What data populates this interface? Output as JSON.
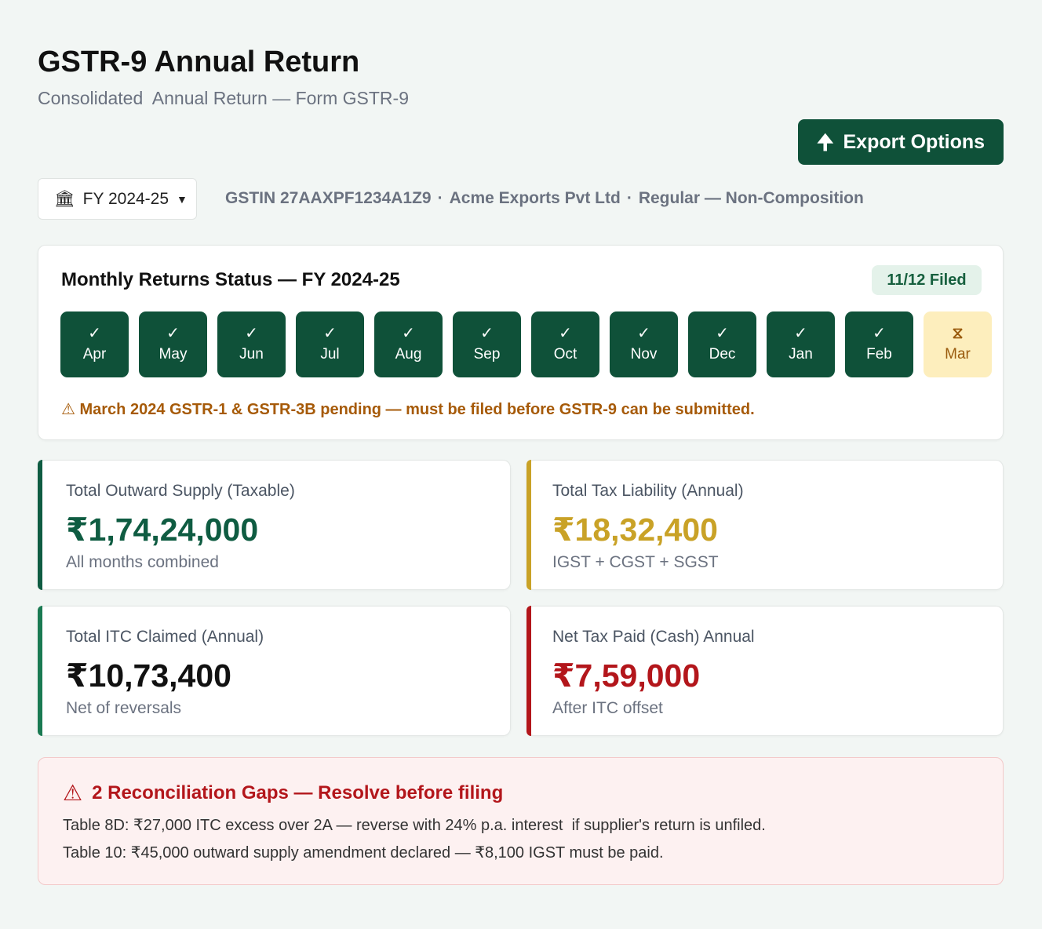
{
  "header": {
    "title": "GSTR-9 Annual Return",
    "subtitle": "Consolidated  Annual Return — Form GSTR-9",
    "export_label": "Export Options",
    "export_icon": "upload-arrow-icon"
  },
  "filters": {
    "fy_label": "FY 2024-25",
    "fy_icon": "bank-icon",
    "gstin": "GSTIN 27AAXPF1234A1Z9",
    "company": "Acme Exports Pvt Ltd",
    "taxpayer_type": "Regular — Non-Composition"
  },
  "status": {
    "title": "Monthly Returns Status — FY 2024-25",
    "filed_badge": "11/12 Filed",
    "months": [
      {
        "label": "Apr",
        "mark": "✓",
        "state": "filed"
      },
      {
        "label": "May",
        "mark": "✓",
        "state": "filed"
      },
      {
        "label": "Jun",
        "mark": "✓",
        "state": "filed"
      },
      {
        "label": "Jul",
        "mark": "✓",
        "state": "filed"
      },
      {
        "label": "Aug",
        "mark": "✓",
        "state": "filed"
      },
      {
        "label": "Sep",
        "mark": "✓",
        "state": "filed"
      },
      {
        "label": "Oct",
        "mark": "✓",
        "state": "filed"
      },
      {
        "label": "Nov",
        "mark": "✓",
        "state": "filed"
      },
      {
        "label": "Dec",
        "mark": "✓",
        "state": "filed"
      },
      {
        "label": "Jan",
        "mark": "✓",
        "state": "filed"
      },
      {
        "label": "Feb",
        "mark": "✓",
        "state": "filed"
      },
      {
        "label": "Mar",
        "mark": "⧖",
        "state": "pending"
      }
    ],
    "warning": "⚠ March 2024 GSTR-1 & GSTR-3B pending — must be filed before GSTR-9 can be submitted."
  },
  "metrics": [
    {
      "label": "Total Outward Supply (Taxable)",
      "value": "₹1,74,24,000",
      "note": "All months combined",
      "color": "#0f5c42"
    },
    {
      "label": "Total Tax Liability (Annual)",
      "value": "₹18,32,400",
      "note": "IGST + CGST + SGST",
      "color": "#c9a227"
    },
    {
      "label": "Total ITC Claimed (Annual)",
      "value": "₹10,73,400",
      "note": "Net of reversals",
      "color": "#1a7a52"
    },
    {
      "label": "Net Tax Paid (Cash) Annual",
      "value": "₹7,59,000",
      "note": "After ITC offset",
      "color": "#b3161b"
    }
  ],
  "alert": {
    "title": "2 Reconciliation Gaps — Resolve before filing",
    "icon": "warning-icon",
    "lines": [
      "Table 8D: ₹27,000 ITC excess over 2A — reverse with 24% p.a. interest  if supplier's return is unfiled.",
      "Table 10: ₹45,000 outward supply amendment declared — ₹8,100 IGST must be paid."
    ]
  },
  "colors": {
    "brand_green": "#0f5139",
    "pending_bg": "#fdeebd",
    "warning_orange": "#a65a08",
    "alert_red": "#b3161b"
  }
}
